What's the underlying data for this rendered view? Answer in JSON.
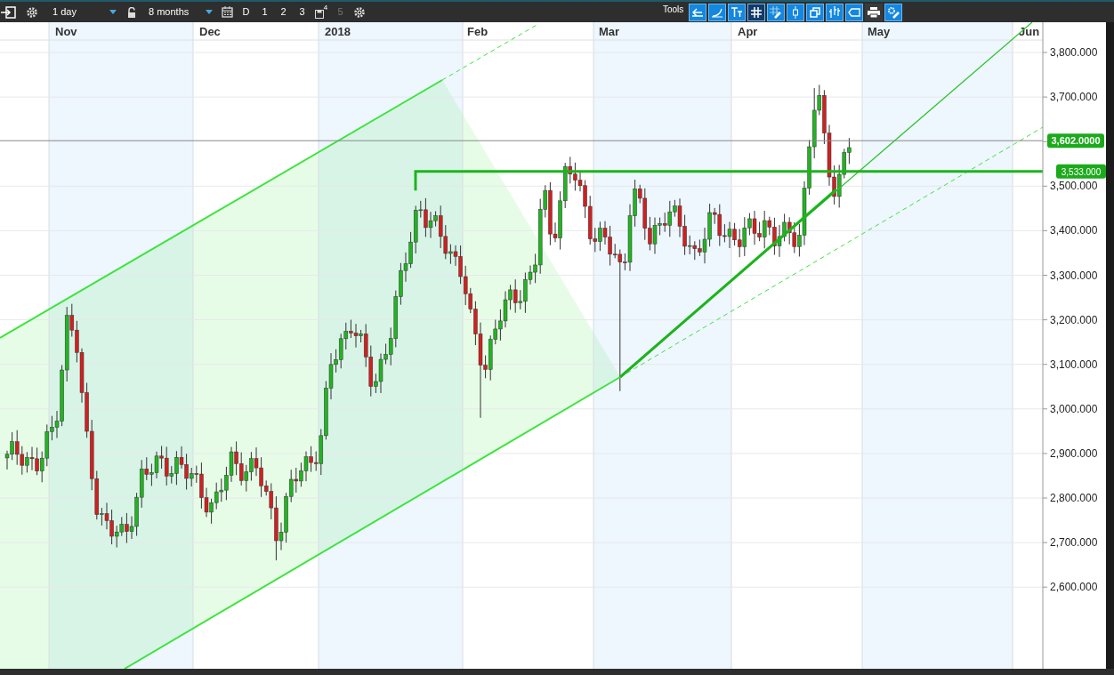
{
  "toolbar": {
    "interval": "1 day",
    "range": "8 months",
    "quick_buttons": [
      {
        "kind": "text",
        "label": "D",
        "disabled": false
      },
      {
        "kind": "text",
        "label": "1",
        "disabled": false
      },
      {
        "kind": "text",
        "label": "2",
        "disabled": false
      },
      {
        "kind": "text",
        "label": "3",
        "disabled": false
      },
      {
        "kind": "save",
        "label": "4",
        "disabled": false
      },
      {
        "kind": "text",
        "label": "5",
        "disabled": true
      }
    ],
    "tools_label": "Tools"
  },
  "chart": {
    "x_labels": [
      "Nov",
      "Dec",
      "2018",
      "Feb",
      "Mar",
      "Apr",
      "May",
      "Jun"
    ],
    "y_labels": [
      "3,800.000",
      "3,700.000",
      "3,500.000",
      "3,400.000",
      "3,300.000",
      "3,200.000",
      "3,100.000",
      "3,000.000",
      "2,900.000",
      "2,800.000",
      "2,700.000",
      "2,600.000"
    ],
    "price_tags": [
      {
        "kind": "current",
        "label": "3,602.0000"
      },
      {
        "kind": "level",
        "label": "3,533.000"
      }
    ]
  }
}
